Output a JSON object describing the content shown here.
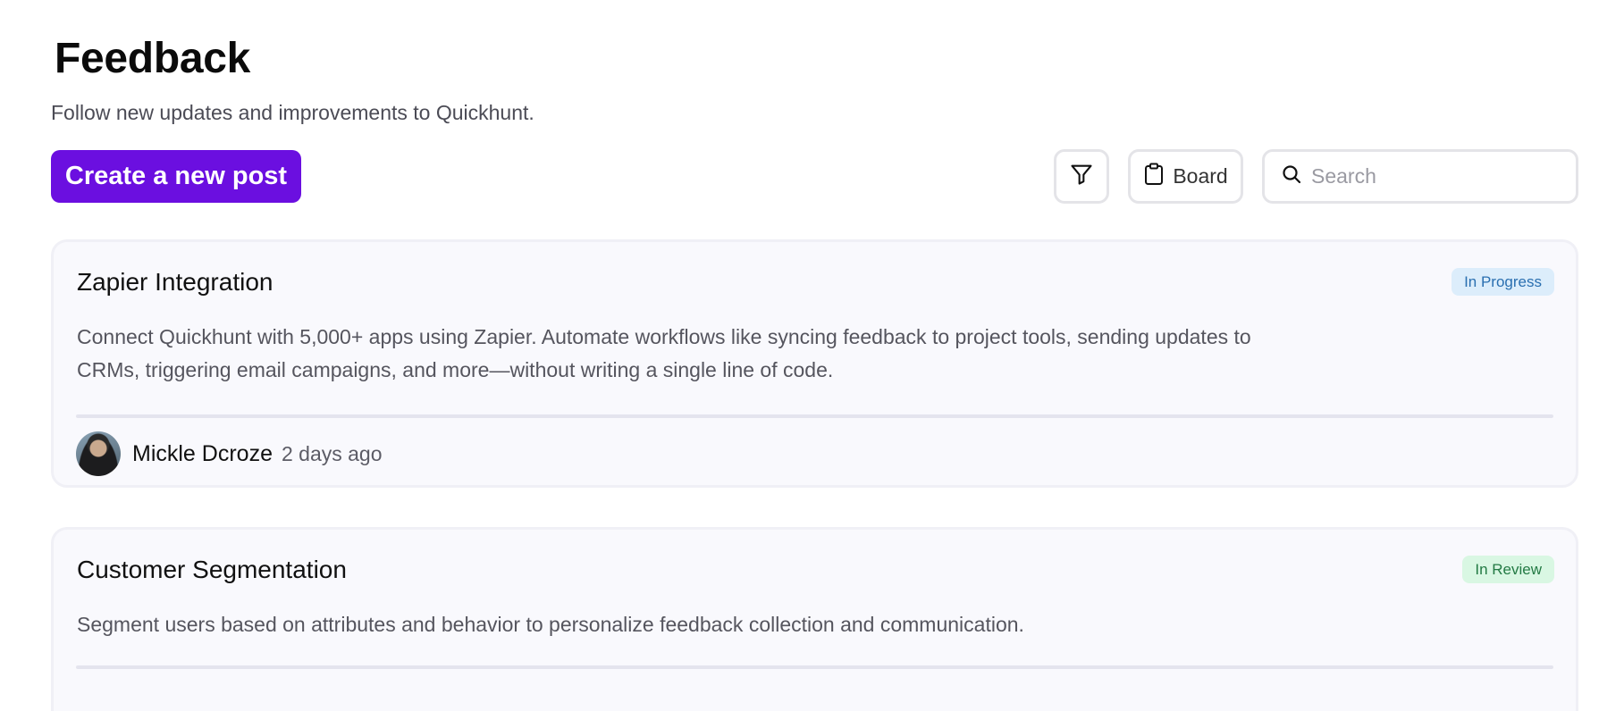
{
  "header": {
    "title": "Feedback",
    "subtitle": "Follow new updates and improvements to Quickhunt."
  },
  "toolbar": {
    "create_label": "Create a new post",
    "filter_icon": "filter-icon",
    "board_icon": "clipboard-icon",
    "board_label": "Board",
    "search_icon": "search-icon",
    "search_placeholder": "Search",
    "search_value": ""
  },
  "colors": {
    "brand": "#6b0fe0",
    "in_progress_bg": "#dcedfb",
    "in_progress_text": "#2a6fb0",
    "in_review_bg": "#d9f7e3",
    "in_review_text": "#237a44"
  },
  "posts": [
    {
      "title": "Zapier Integration",
      "status": "In Progress",
      "description": "Connect Quickhunt with 5,000+ apps using Zapier. Automate workflows like syncing feedback to project tools, sending updates to CRMs, triggering email campaigns, and more—without writing a single line of code.",
      "author": "Mickle Dcroze",
      "time_ago": "2 days ago"
    },
    {
      "title": "Customer Segmentation",
      "status": "In Review",
      "description": "Segment users based on attributes and behavior to personalize feedback collection and communication."
    }
  ]
}
